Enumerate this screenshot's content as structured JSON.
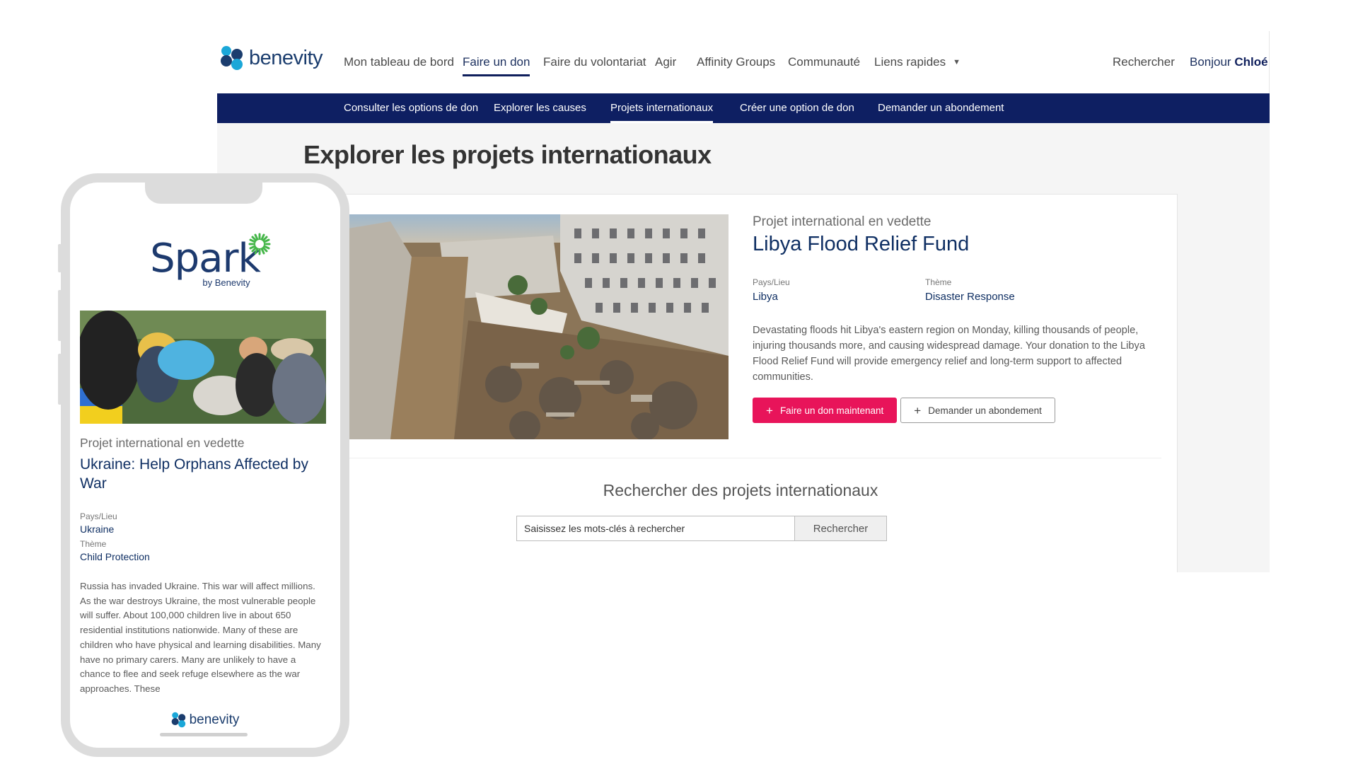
{
  "brand": {
    "name": "benevity",
    "colors": {
      "navy": "#0e1f62",
      "accent": "#e8145a",
      "link": "#0f2f63"
    }
  },
  "topnav": {
    "items": [
      {
        "label": "Mon tableau de bord"
      },
      {
        "label": "Faire un don",
        "active": true
      },
      {
        "label": "Faire du volontariat"
      },
      {
        "label": "Agir"
      },
      {
        "label": "Affinity Groups"
      },
      {
        "label": "Communauté"
      },
      {
        "label": "Liens rapides"
      },
      {
        "label": "Rechercher"
      }
    ],
    "greeting": "Bonjour",
    "user": "Chloé"
  },
  "subnav": {
    "items": [
      {
        "label": "Consulter les options de don"
      },
      {
        "label": "Explorer les causes"
      },
      {
        "label": "Projets internationaux",
        "active": true
      },
      {
        "label": "Créer une option de don"
      },
      {
        "label": "Demander un abondement"
      }
    ]
  },
  "page": {
    "title": "Explorer les projets internationaux"
  },
  "featured": {
    "eyebrow": "Projet international en vedette",
    "name": "Libya Flood Relief Fund",
    "country_label": "Pays/Lieu",
    "country": "Libya",
    "theme_label": "Thème",
    "theme": "Disaster Response",
    "description": "Devastating floods hit Libya's eastern region on Monday, killing thousands of people, injuring thousands more, and causing widespread damage. Your donation to the Libya Flood Relief Fund will provide emergency relief and long-term support to affected communities.",
    "donate_label": "Faire un don maintenant",
    "match_label": "Demander un abondement"
  },
  "search": {
    "title": "Rechercher des projets internationaux",
    "placeholder": "Saisissez les mots-clés à rechercher",
    "button": "Rechercher"
  },
  "mobile": {
    "logo_word": "Spark",
    "logo_by": "by Benevity",
    "eyebrow": "Projet international en vedette",
    "name": "Ukraine: Help Orphans Affected by War",
    "country_label": "Pays/Lieu",
    "country": "Ukraine",
    "theme_label": "Thème",
    "theme": "Child Protection",
    "description": "Russia has invaded Ukraine. This war will affect millions. As the war destroys Ukraine, the most vulnerable people will suffer. About 100,000 children live in about 650 residential institutions nationwide. Many of these are children who have physical and learning disabilities. Many have no primary carers. Many are unlikely to have a chance to flee and seek refuge elsewhere as the war approaches. These",
    "footer_brand": "benevity"
  }
}
